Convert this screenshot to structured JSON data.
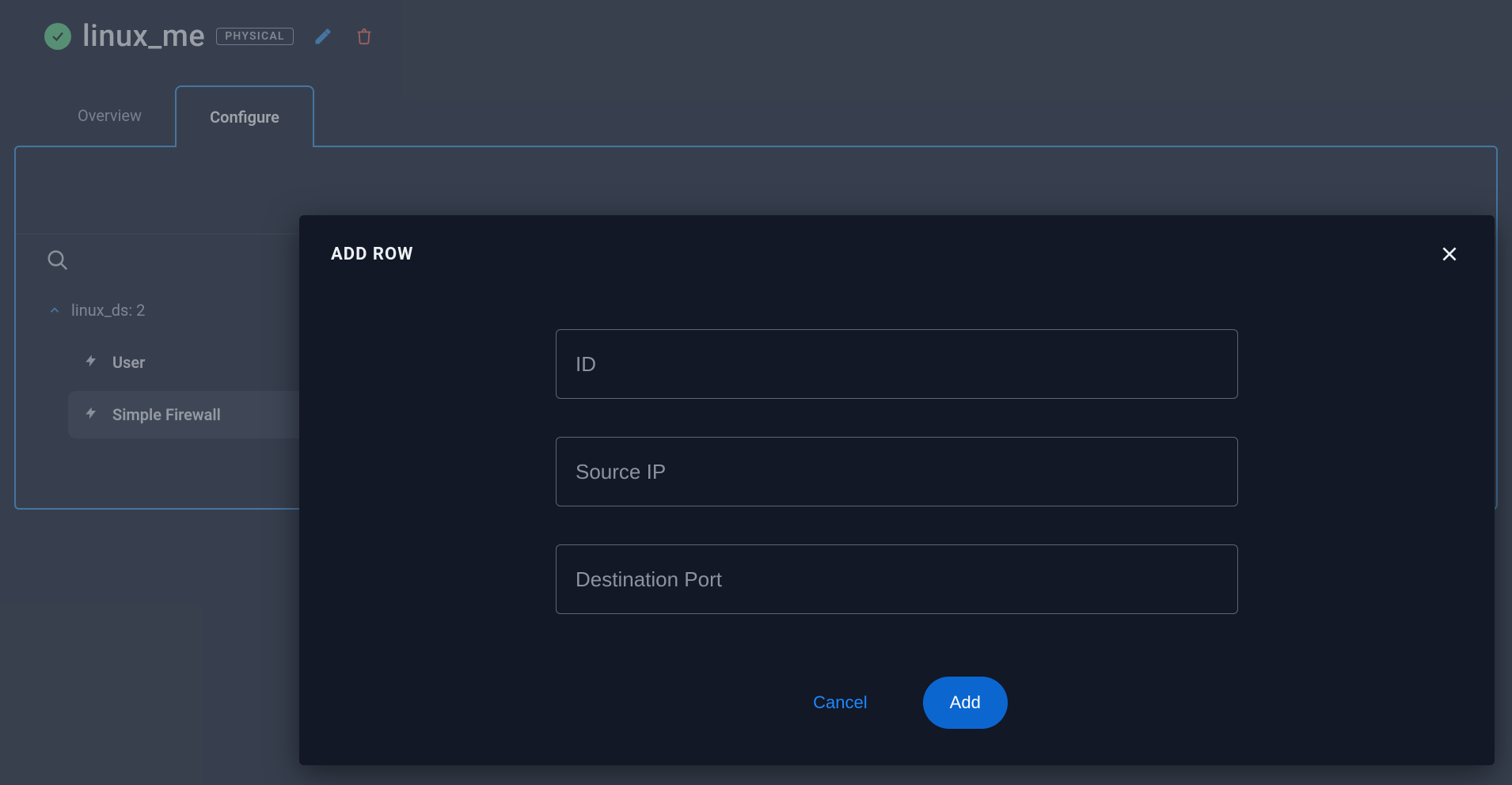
{
  "header": {
    "title": "linux_me",
    "badge": "PHYSICAL"
  },
  "tabs": {
    "overview": "Overview",
    "configure": "Configure"
  },
  "tree": {
    "group_label": "linux_ds: 2",
    "items": [
      {
        "label": "User"
      },
      {
        "label": "Simple Firewall"
      }
    ]
  },
  "modal": {
    "title": "ADD ROW",
    "fields": {
      "id_placeholder": "ID",
      "source_ip_placeholder": "Source IP",
      "dest_port_placeholder": "Destination Port"
    },
    "actions": {
      "cancel": "Cancel",
      "add": "Add"
    }
  }
}
